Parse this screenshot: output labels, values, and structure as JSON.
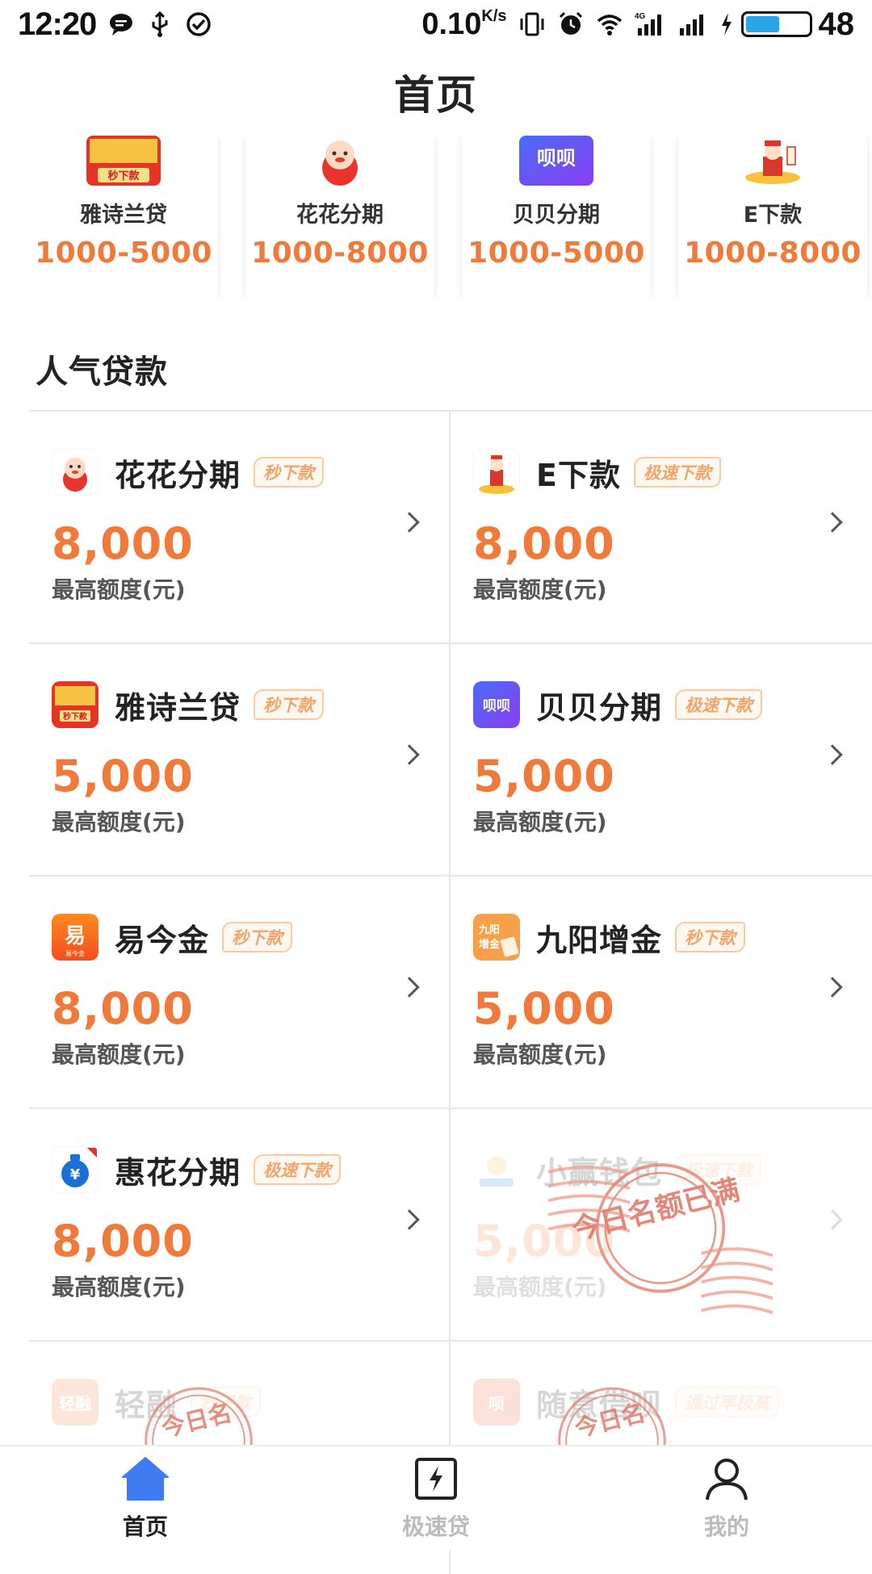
{
  "status_bar": {
    "time": "12:20",
    "speed": "0.10",
    "speed_unit": "K/s",
    "battery": "48",
    "network": "4G"
  },
  "header": {
    "title": "首页"
  },
  "top_products": [
    {
      "name": "雅诗兰贷",
      "range": "1000-5000",
      "logo": "yashilan-logo"
    },
    {
      "name": "花花分期",
      "range": "1000-8000",
      "logo": "huahua-logo"
    },
    {
      "name": "贝贝分期",
      "range": "1000-5000",
      "logo": "beibei-logo"
    },
    {
      "name": "E下款",
      "range": "1000-8000",
      "logo": "exiakuan-logo"
    }
  ],
  "section": {
    "title": "人气贷款"
  },
  "loans": [
    {
      "name": "花花分期",
      "badge": "秒下款",
      "amount": "8,000",
      "sub": "最高额度(元)"
    },
    {
      "name": "E下款",
      "badge": "极速下款",
      "amount": "8,000",
      "sub": "最高额度(元)"
    },
    {
      "name": "雅诗兰贷",
      "badge": "秒下款",
      "amount": "5,000",
      "sub": "最高额度(元)"
    },
    {
      "name": "贝贝分期",
      "badge": "极速下款",
      "amount": "5,000",
      "sub": "最高额度(元)"
    },
    {
      "name": "易今金",
      "badge": "秒下款",
      "amount": "8,000",
      "sub": "最高额度(元)"
    },
    {
      "name": "九阳增金",
      "badge": "秒下款",
      "amount": "5,000",
      "sub": "最高额度(元)"
    },
    {
      "name": "惠花分期",
      "badge": "极速下款",
      "amount": "8,000",
      "sub": "最高额度(元)"
    },
    {
      "name": "小赢钱包",
      "badge": "极速下款",
      "amount": "5,000",
      "sub": "最高额度(元)",
      "stamp": "今日名额已满"
    },
    {
      "name": "轻融",
      "badge": "秒下款",
      "amount": "",
      "sub": "",
      "stamp": "今日名"
    },
    {
      "name": "随意借呗",
      "badge": "通过率极高",
      "amount": "",
      "sub": "",
      "stamp": "今日名"
    }
  ],
  "bottom_nav": [
    {
      "label": "首页",
      "icon": "home-icon",
      "active": true
    },
    {
      "label": "极速贷",
      "icon": "lightning-icon",
      "active": false
    },
    {
      "label": "我的",
      "icon": "user-icon",
      "active": false
    }
  ],
  "colors": {
    "accent_orange": "#f07a3a",
    "badge_orange": "#f4a46a",
    "nav_blue": "#3f7cf4",
    "stamp_red": "#e06b5a"
  }
}
